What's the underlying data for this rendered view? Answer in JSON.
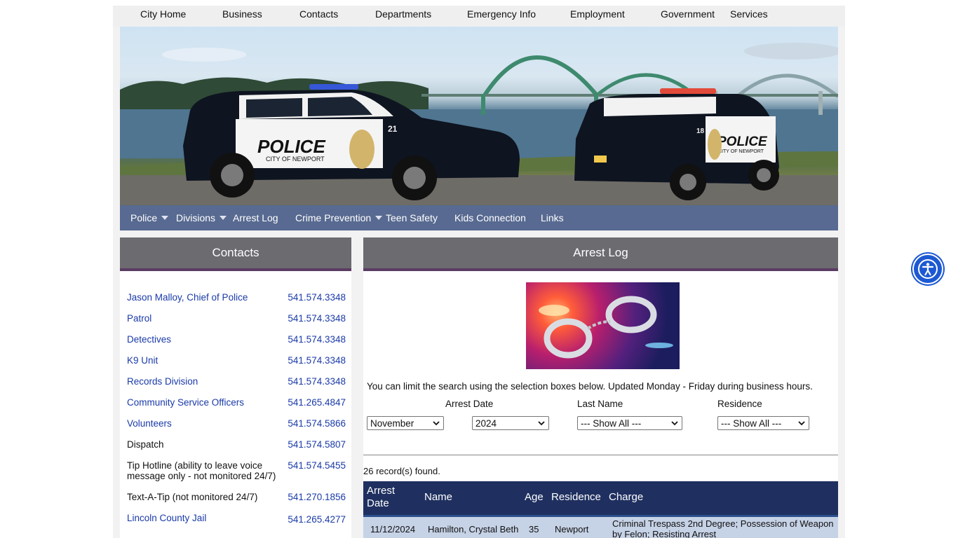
{
  "top_nav": [
    "City Home",
    "Business",
    "Contacts",
    "Departments",
    "Emergency Info",
    "Employment",
    "Government",
    "Services"
  ],
  "hero": {
    "car_left_text": "POLICE",
    "car_left_sub": "CITY OF NEWPORT",
    "car_left_number": "21",
    "car_right_text": "POLICE",
    "car_right_sub": "CITY OF NEWPORT",
    "car_right_number": "18"
  },
  "police_nav": [
    {
      "label": "Police",
      "dropdown": true
    },
    {
      "label": "Divisions",
      "dropdown": true
    },
    {
      "label": "Arrest Log",
      "dropdown": false
    },
    {
      "label": "Crime Prevention",
      "dropdown": true
    },
    {
      "label": "Teen Safety",
      "dropdown": false
    },
    {
      "label": "Kids Connection",
      "dropdown": false
    },
    {
      "label": "Links",
      "dropdown": false
    }
  ],
  "contacts": {
    "title": "Contacts",
    "items": [
      {
        "name": "Jason Malloy, Chief of Police",
        "phone": "541.574.3348",
        "link": true
      },
      {
        "name": "Patrol",
        "phone": "541.574.3348",
        "link": true
      },
      {
        "name": "Detectives",
        "phone": "541.574.3348",
        "link": true
      },
      {
        "name": "K9 Unit",
        "phone": "541.574.3348",
        "link": true
      },
      {
        "name": "Records Division",
        "phone": "541.574.3348",
        "link": true
      },
      {
        "name": "Community Service Officers",
        "phone": "541.265.4847",
        "link": true
      },
      {
        "name": "Volunteers",
        "phone": "541.574.5866",
        "link": true
      },
      {
        "name": "Dispatch",
        "phone": "541.574.5807",
        "link": false
      },
      {
        "name": "Tip Hotline (ability to leave voice message only - not monitored 24/7)",
        "phone": "541.574.5455",
        "link": false
      },
      {
        "name": "Text-A-Tip (not monitored 24/7)",
        "phone": "541.270.1856",
        "link": false
      },
      {
        "name": "Lincoln County Jail",
        "phone": "541.265.4277",
        "link": true
      }
    ]
  },
  "arrest_log": {
    "title": "Arrest Log",
    "note": "You can limit the search using the selection boxes below. Updated Monday - Friday during business hours.",
    "filters": {
      "arrest_date_label": "Arrest Date",
      "last_name_label": "Last Name",
      "residence_label": "Residence",
      "month": "November",
      "year": "2024",
      "last_name": "--- Show All ---",
      "residence": "--- Show All ---"
    },
    "records_found": "26 record(s) found.",
    "columns": [
      "Arrest Date",
      "Name",
      "Age",
      "Residence",
      "Charge"
    ],
    "rows": [
      {
        "date": "11/12/2024",
        "name": "Hamilton, Crystal Beth",
        "age": "35",
        "residence": "Newport",
        "charge": "Criminal Trespass 2nd Degree; Possession of Weapon by Felon; Resisting Arrest"
      }
    ]
  },
  "colors": {
    "police_nav_bg": "#586a91",
    "panel_header_bg": "#6c6b70",
    "panel_header_border": "#5a3d63",
    "table_header_bg": "#1f3060",
    "table_row_bg": "#c6d2e6",
    "link": "#1a3aa8",
    "a11y_button": "#1d59d3"
  },
  "icons": {
    "accessibility": "accessibility-person-icon",
    "dropdown_caret": "caret-down-icon"
  }
}
